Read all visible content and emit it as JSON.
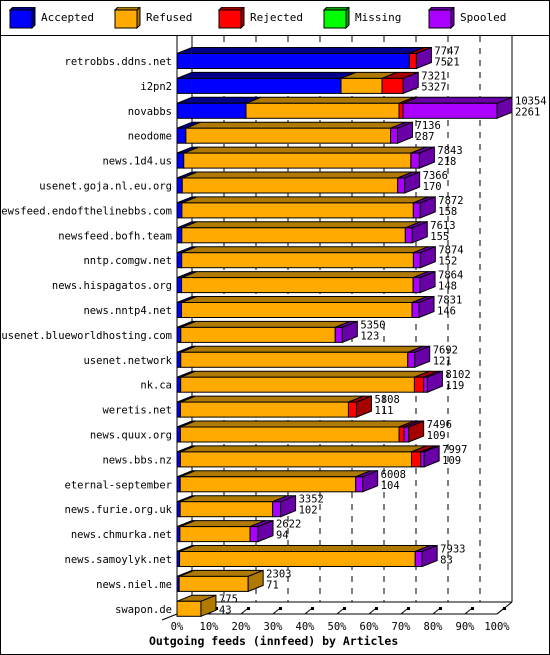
{
  "legend": [
    {
      "label": "Accepted",
      "color": "#0000ff",
      "side": "#00008b"
    },
    {
      "label": "Refused",
      "color": "#ffaa00",
      "side": "#b07a00"
    },
    {
      "label": "Rejected",
      "color": "#ff0000",
      "side": "#a80000"
    },
    {
      "label": "Missing",
      "color": "#00ff00",
      "side": "#00a000"
    },
    {
      "label": "Spooled",
      "color": "#aa00ff",
      "side": "#6a00a8"
    }
  ],
  "chart_data": {
    "type": "bar",
    "orientation": "horizontal-stacked-3d",
    "title": "",
    "xlabel": "Outgoing feeds (innfeed) by Articles",
    "ylabel": "",
    "x_ticks": [
      "0%",
      "10%",
      "20%",
      "30%",
      "40%",
      "50%",
      "60%",
      "70%",
      "80%",
      "90%",
      "100%"
    ],
    "xlim": [
      0,
      100
    ],
    "grid": true,
    "legend_position": "top",
    "max_total": 10354,
    "series_names": [
      "Accepted",
      "Refused",
      "Rejected",
      "Missing",
      "Spooled"
    ],
    "categories": [
      "retrobbs.ddns.net",
      "i2pn2",
      "novabbs",
      "neodome",
      "news.1d4.us",
      "usenet.goja.nl.eu.org",
      "newsfeed.endofthelinebbs.com",
      "newsfeed.bofh.team",
      "nntp.comgw.net",
      "news.hispagatos.org",
      "news.nntp4.net",
      "usenet.blueworldhosting.com",
      "usenet.network",
      "nk.ca",
      "weretis.net",
      "news.quux.org",
      "news.bbs.nz",
      "eternal-september",
      "news.furie.org.uk",
      "news.chmurka.net",
      "news.samoylyk.net",
      "news.niel.me",
      "swapon.de"
    ],
    "totals": [
      7747,
      7321,
      10354,
      7136,
      7843,
      7366,
      7872,
      7613,
      7874,
      7864,
      7831,
      5350,
      7692,
      8102,
      5808,
      7496,
      7997,
      6008,
      3352,
      2622,
      7933,
      2303,
      775
    ],
    "secondary": [
      7521,
      5327,
      2261,
      287,
      218,
      170,
      158,
      155,
      152,
      148,
      146,
      123,
      121,
      119,
      111,
      109,
      109,
      104,
      102,
      94,
      83,
      71,
      43
    ],
    "series": [
      {
        "name": "Accepted",
        "values": [
          7520,
          5307,
          2233,
          287,
          218,
          170,
          158,
          155,
          152,
          148,
          146,
          123,
          121,
          119,
          111,
          109,
          109,
          104,
          102,
          94,
          83,
          71,
          0
        ]
      },
      {
        "name": "Refused",
        "values": [
          0,
          1327,
          4950,
          6624,
          7350,
          6971,
          7489,
          7233,
          7497,
          7491,
          7460,
          4996,
          7346,
          7563,
          5436,
          7077,
          7478,
          5679,
          2990,
          2268,
          7625,
          2232,
          775
        ]
      },
      {
        "name": "Rejected",
        "values": [
          227,
          687,
          130,
          0,
          0,
          0,
          0,
          0,
          0,
          0,
          0,
          0,
          0,
          300,
          261,
          160,
          300,
          0,
          0,
          0,
          0,
          0,
          0
        ]
      },
      {
        "name": "Missing",
        "values": [
          0,
          0,
          0,
          0,
          0,
          0,
          0,
          0,
          0,
          0,
          0,
          0,
          0,
          0,
          0,
          0,
          0,
          0,
          0,
          0,
          0,
          0,
          0
        ]
      },
      {
        "name": "Spooled",
        "values": [
          0,
          0,
          3041,
          225,
          275,
          225,
          225,
          225,
          225,
          225,
          225,
          231,
          225,
          120,
          0,
          150,
          110,
          225,
          260,
          260,
          225,
          0,
          0
        ]
      }
    ],
    "end_cap_series": [
      "Spooled",
      "Spooled",
      "Spooled",
      "Spooled",
      "Spooled",
      "Spooled",
      "Spooled",
      "Spooled",
      "Spooled",
      "Spooled",
      "Spooled",
      "Spooled",
      "Spooled",
      "Spooled",
      "Rejected",
      "Rejected",
      "Spooled",
      "Spooled",
      "Spooled",
      "Spooled",
      "Spooled",
      "Refused",
      "Refused"
    ]
  }
}
